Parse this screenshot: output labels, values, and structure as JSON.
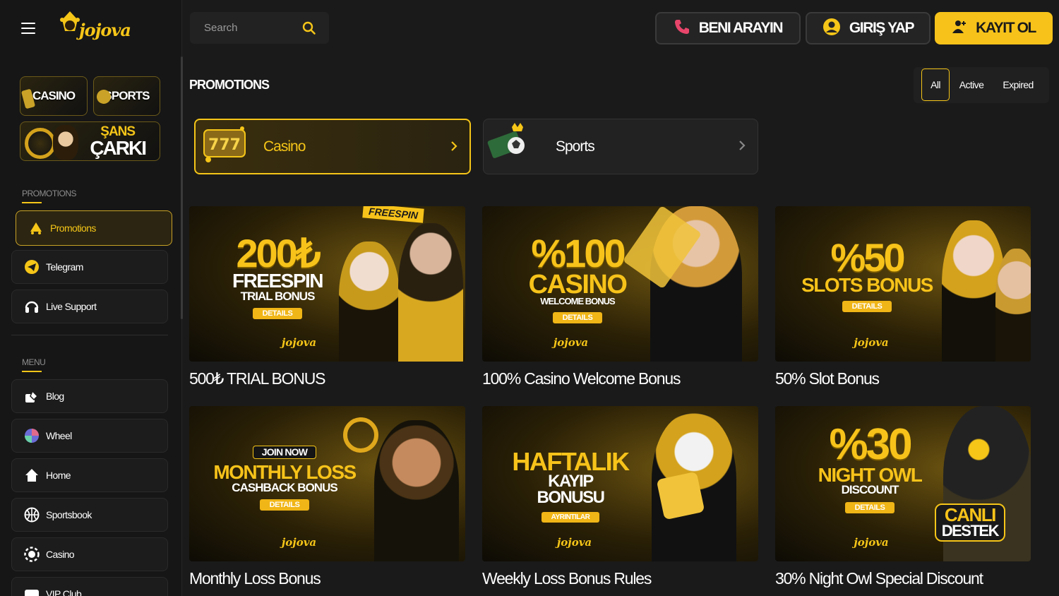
{
  "brand": {
    "name": "jojova"
  },
  "search": {
    "placeholder": "Search"
  },
  "header": {
    "call_label": "BENI ARAYIN",
    "login_label": "GIRIŞ YAP",
    "register_label": "KAYIT OL",
    "colors": {
      "accent": "#f7c31a",
      "call_icon": "#e8456b"
    }
  },
  "sidebar": {
    "tiles": {
      "casino": "CASINO",
      "sports": "SPORTS",
      "wheel_top": "ŞANS",
      "wheel_bottom": "ÇARKI"
    },
    "promotions_heading": "PROMOTIONS",
    "promo_items": [
      {
        "label": "Promotions",
        "icon": "gift-icon"
      },
      {
        "label": "Telegram",
        "icon": "telegram-icon"
      },
      {
        "label": "Live Support",
        "icon": "headset-icon"
      }
    ],
    "menu_heading": "MENU",
    "menu_items": [
      {
        "label": "Blog",
        "icon": "blog-icon"
      },
      {
        "label": "Wheel",
        "icon": "wheel-icon"
      },
      {
        "label": "Home",
        "icon": "home-icon"
      },
      {
        "label": "Sportsbook",
        "icon": "basketball-icon"
      },
      {
        "label": "Casino",
        "icon": "casino-chip-icon"
      },
      {
        "label": "VIP Club",
        "icon": "vip-icon"
      }
    ]
  },
  "main": {
    "title": "PROMOTIONS",
    "filters": [
      "All",
      "Active",
      "Expired"
    ],
    "active_filter": "All",
    "categories": [
      {
        "label": "Casino"
      },
      {
        "label": "Sports"
      }
    ],
    "promos": [
      {
        "title": "500₺ TRIAL BONUS",
        "banner": {
          "ribbon": "FREESPIN",
          "big": "200₺",
          "line1": "FREESPIN",
          "line2": "TRIAL BONUS",
          "button": "DETAILS",
          "logo": "jojova"
        }
      },
      {
        "title": "100% Casino Welcome Bonus",
        "banner": {
          "big": "%100",
          "line1": "CASINO",
          "line2": "WELCOME BONUS",
          "button": "DETAILS",
          "logo": "jojova"
        }
      },
      {
        "title": "50% Slot Bonus",
        "banner": {
          "big": "%50",
          "line1": "SLOTS BONUS",
          "button": "DETAILS",
          "logo": "jojova"
        }
      },
      {
        "title": "Monthly Loss Bonus",
        "banner": {
          "pill": "JOIN NOW",
          "line1": "MONTHLY LOSS",
          "line2": "CASHBACK BONUS",
          "button": "DETAILS",
          "logo": "jojova"
        }
      },
      {
        "title": "Weekly Loss Bonus Rules",
        "banner": {
          "line1": "HAFTALIK",
          "line2": "KAYIP",
          "line3": "BONUSU",
          "button": "AYRINTILAR",
          "logo": "jojova"
        }
      },
      {
        "title": "30% Night Owl Special Discount",
        "banner": {
          "big": "%30",
          "line1": "NIGHT OWL",
          "line2": "DISCOUNT",
          "button": "DETAILS",
          "logo": "jojova",
          "badge_top": "CANLI",
          "badge_bottom": "DESTEK"
        }
      }
    ]
  }
}
